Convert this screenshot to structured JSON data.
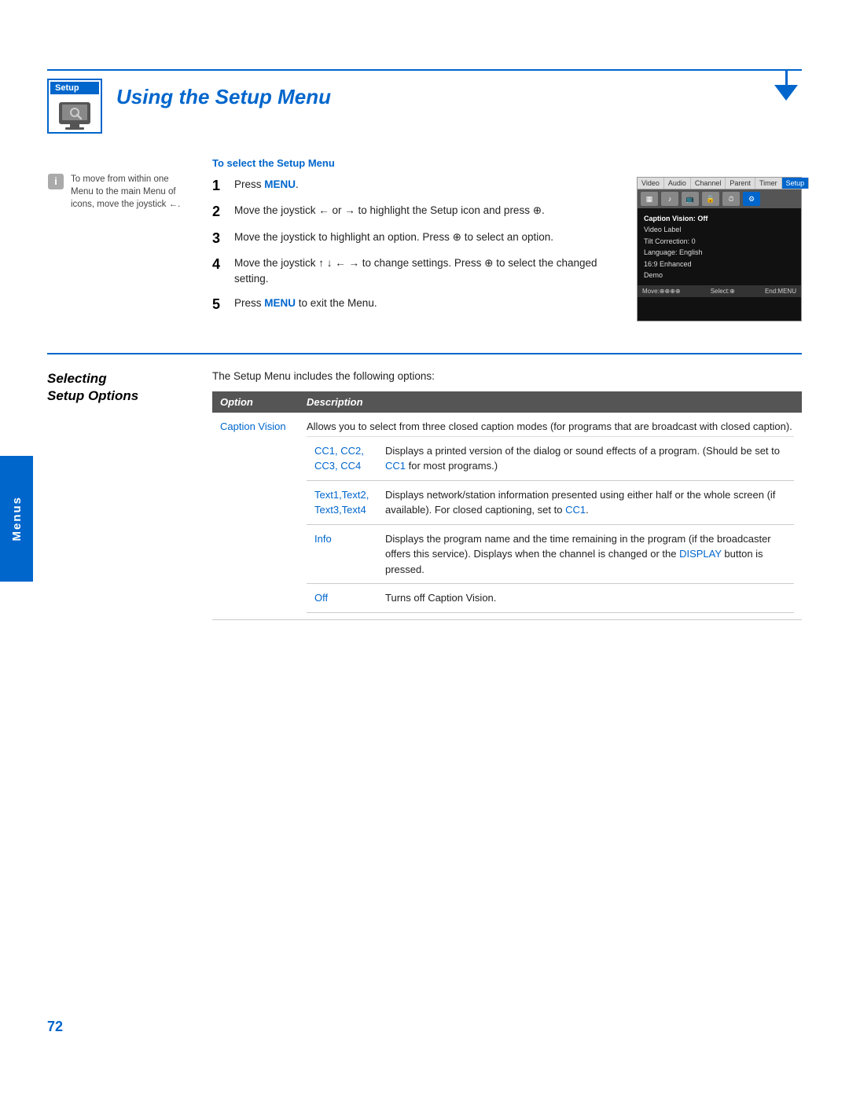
{
  "page": {
    "number": "72",
    "tab_label": "Menus"
  },
  "header": {
    "setup_label": "Setup",
    "title": "Using the Setup Menu"
  },
  "to_select": {
    "subtitle": "To select the Setup Menu",
    "steps": [
      {
        "num": "1",
        "text": "Press ",
        "highlight": "MENU",
        "rest": "."
      },
      {
        "num": "2",
        "text": "Move the joystick ← or → to highlight the Setup icon and press ⊕."
      },
      {
        "num": "3",
        "text": "Move the joystick to highlight an option. Press ⊕ to select an option."
      },
      {
        "num": "4",
        "text": "Move the joystick ↑ ↓ ← → to change settings. Press ⊕ to select the changed setting."
      },
      {
        "num": "5",
        "text": "Press ",
        "highlight": "MENU",
        "rest": " to exit the Menu."
      }
    ]
  },
  "side_note": "To move from within one Menu to the main Menu of icons, move the joystick ←.",
  "tv_screen": {
    "tabs": [
      "Video",
      "Audio",
      "Channel",
      "Parent",
      "Timer",
      "Setup"
    ],
    "active_tab": "Setup",
    "menu_items": [
      "Caption Vision: Off",
      "Video Label",
      "Tilt Correction: 0",
      "Language: English",
      "16:9 Enhanced",
      "Demo"
    ],
    "footer": {
      "move": "Move:⊕⊕⊕⊕",
      "select": "Select:⊕",
      "end": "End:MENU"
    }
  },
  "selecting_section": {
    "title_line1": "Selecting",
    "title_line2": "Setup Options",
    "intro": "The Setup Menu includes the following options:",
    "table": {
      "col_option": "Option",
      "col_description": "Description",
      "rows": [
        {
          "option": "Caption Vision",
          "description": "Allows you to select from three closed caption modes (for programs that are broadcast with closed caption).",
          "sub_rows": [
            {
              "name": "CC1, CC2, CC3, CC4",
              "desc": "Displays a printed version of the dialog or sound effects of a program. (Should be set to CC1 for most programs.)"
            },
            {
              "name": "Text1,Text2, Text3,Text4",
              "desc": "Displays network/station information presented using either half or the whole screen (if available). For closed captioning, set to CC1."
            },
            {
              "name": "Info",
              "desc": "Displays the program name and the time remaining in the program (if the broadcaster offers this service). Displays when the channel is changed or the DISPLAY button is pressed."
            },
            {
              "name": "Off",
              "desc": "Turns off Caption Vision."
            }
          ]
        }
      ]
    }
  },
  "colors": {
    "accent": "#0066cc",
    "header_bg": "#555555",
    "tab_bg": "#0066cc"
  }
}
